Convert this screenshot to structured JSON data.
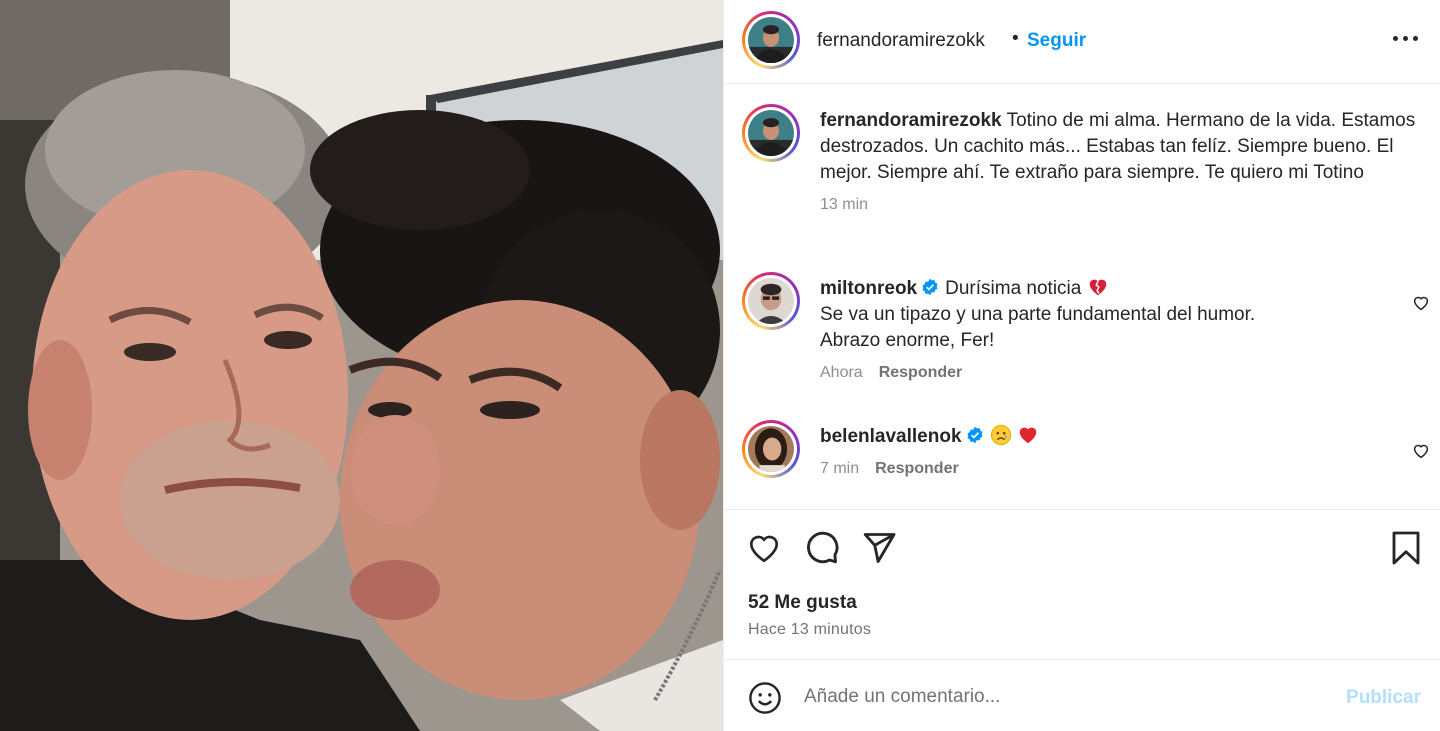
{
  "post": {
    "author": "fernandoramirezokk",
    "follow_label": "Seguir",
    "separator": "•",
    "caption": "Totino de mi alma. Hermano de la vida. Estamos destrozados. Un cachito más... Estabas tan felíz. Siempre bueno. El mejor. Siempre ahí. Te extraño para siempre. Te quiero mi Totino",
    "caption_time": "13 min",
    "likes": "52 Me gusta",
    "posted": "Hace 13 minutos"
  },
  "comments": [
    {
      "user": "milton­reok",
      "verified": true,
      "text_line1": "Durísima noticia",
      "emoji": "broken-heart",
      "text_line2": "Se va un tipazo y una parte fundamental del humor.",
      "text_line3": "Abrazo enorme, Fer!",
      "time": "Ahora",
      "reply_label": "Responder"
    },
    {
      "user": "belenlavallenok",
      "verified": true,
      "emojis": [
        "sad-face",
        "red-heart"
      ],
      "time": "7 min",
      "reply_label": "Responder"
    }
  ],
  "comment_box": {
    "placeholder": "Añade un comentario...",
    "publish_label": "Publicar"
  },
  "colors": {
    "link_blue": "#0095f6",
    "publish_disabled": "#b2dffc",
    "verified_blue": "#0095f6",
    "secondary_text": "#737373"
  },
  "icons": [
    "more-options-icon",
    "heart-icon",
    "comment-icon",
    "share-icon",
    "bookmark-icon",
    "emoji-icon",
    "verified-icon"
  ]
}
